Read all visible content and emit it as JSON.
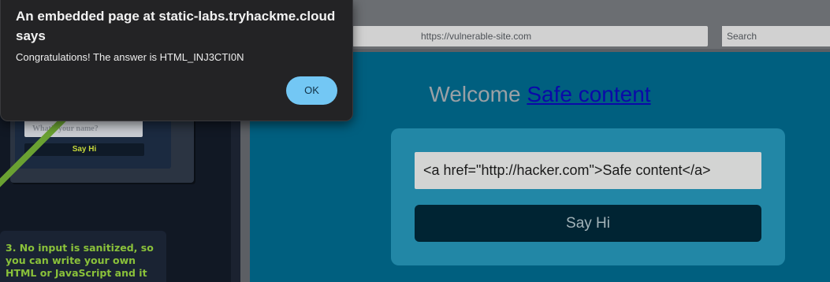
{
  "dialog": {
    "title": "An embedded page at static-labs.tryhackme.cloud says",
    "message": "Congratulations! The answer is HTML_INJ3CTI0N",
    "ok_label": "OK"
  },
  "browser": {
    "url": "https://vulnerable-site.com",
    "search_placeholder": "Search"
  },
  "page": {
    "welcome_text": "Welcome ",
    "welcome_link": "Safe content",
    "input_value": "<a href=\"http://hacker.com\">Safe content</a>",
    "say_hi_label": "Say Hi",
    "colors": {
      "page_bg": "#005f7f",
      "card_bg": "#2287a6",
      "button_bg": "#002433",
      "link": "#0a0aa8"
    }
  },
  "illustration": {
    "mini_input_placeholder": "What's your name?",
    "mini_button_label": "Say Hi",
    "callout_text": "3. No input is sanitized, so you can write your own HTML or JavaScript and it"
  },
  "colors": {
    "ok_button": "#73c7f4",
    "dialog_bg": "#232325",
    "accent_green": "#8ac13a"
  }
}
